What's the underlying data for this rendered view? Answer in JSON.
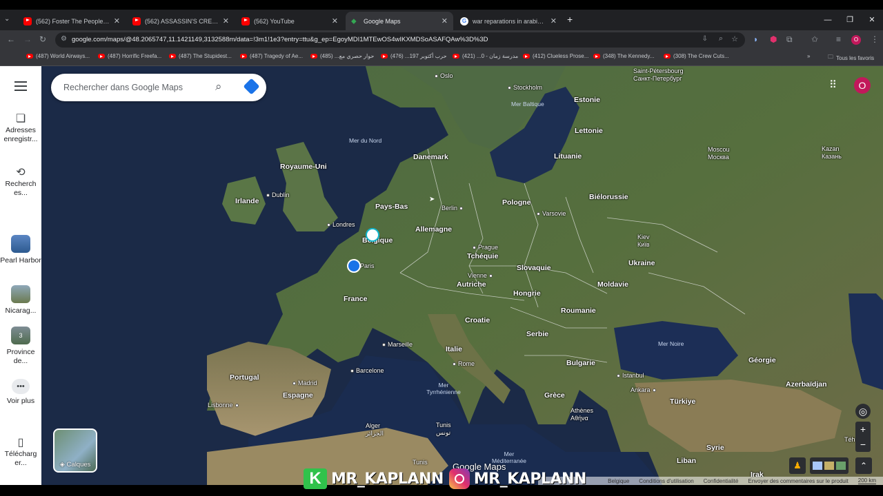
{
  "tabs": [
    {
      "title": "(562) Foster The People - Pump",
      "icon": "youtube-icon"
    },
    {
      "title": "(562) ASSASSIN'S CREED VALHA",
      "icon": "youtube-icon"
    },
    {
      "title": "(562) YouTube",
      "icon": "youtube-icon"
    },
    {
      "title": "Google Maps",
      "icon": "google-maps-icon",
      "active": true
    },
    {
      "title": "war reparations in arabic - Goo",
      "icon": "google-icon"
    }
  ],
  "address": {
    "url": "google.com/maps/@48.2065747,11.1421149,3132588m/data=!3m1!1e3?entry=ttu&g_ep=EgoyMDI1MTEwOS4wIKXMDSoASAFQAw%3D%3D"
  },
  "bookmarks": [
    "(487) World Airways...",
    "(487) Horrific Freefa...",
    "(487) The Stupidest...",
    "(487) Tragedy of Ae...",
    "حوار حصري مع... (485)",
    "حرب أكتوبر 197... (476)",
    "مدرسة زمان - 0... (421)",
    "(412) Clueless Prose...",
    "(348) The Kennedy...",
    "(308) The Crew Cuts..."
  ],
  "bookmarks_folder": "Tous les favoris",
  "profile_initial": "O",
  "sidebar": {
    "saved": "Adresses enregistr...",
    "recent": "Recherch es...",
    "places": [
      "Pearl Harbor",
      "Nicarag...",
      "Province de..."
    ],
    "places_badge": "3",
    "more": "Voir plus",
    "download": "Télécharg er..."
  },
  "search": {
    "placeholder": "Rechercher dans Google Maps"
  },
  "map": {
    "countries": [
      {
        "t": "Royaume-Uni"
      },
      {
        "t": "Irlande"
      },
      {
        "t": "Danemark"
      },
      {
        "t": "Pays-Bas"
      },
      {
        "t": "Belgique"
      },
      {
        "t": "Allemagne"
      },
      {
        "t": "Pologne"
      },
      {
        "t": "Tchéquie"
      },
      {
        "t": "Slovaquie"
      },
      {
        "t": "Autriche"
      },
      {
        "t": "Hongrie"
      },
      {
        "t": "France"
      },
      {
        "t": "Croatie"
      },
      {
        "t": "Serbie"
      },
      {
        "t": "Roumanie"
      },
      {
        "t": "Moldavie"
      },
      {
        "t": "Ukraine"
      },
      {
        "t": "Biélorussie"
      },
      {
        "t": "Lituanie"
      },
      {
        "t": "Lettonie"
      },
      {
        "t": "Estonie"
      },
      {
        "t": "Italie"
      },
      {
        "t": "Bulgarie"
      },
      {
        "t": "Grèce"
      },
      {
        "t": "Portugal"
      },
      {
        "t": "Espagne"
      },
      {
        "t": "Türkiye"
      },
      {
        "t": "Géorgie"
      },
      {
        "t": "Azerbaïdjan"
      },
      {
        "t": "Syrie"
      },
      {
        "t": "Liban"
      },
      {
        "t": "Irak"
      }
    ],
    "cities": [
      {
        "t": "Oslo"
      },
      {
        "t": "Stockholm"
      },
      {
        "t": "Dublin"
      },
      {
        "t": "Londres"
      },
      {
        "t": "Berlin"
      },
      {
        "t": "Varsovie"
      },
      {
        "t": "Paris"
      },
      {
        "t": "Prague"
      },
      {
        "t": "Vienne"
      },
      {
        "t": "Marseille"
      },
      {
        "t": "Barcelone"
      },
      {
        "t": "Madrid"
      },
      {
        "t": "Lisbonne"
      },
      {
        "t": "Rome"
      },
      {
        "t": "Istanbul"
      },
      {
        "t": "Ankara"
      }
    ],
    "cities_bilingual": [
      {
        "a": "Saint-Pétersbourg",
        "b": "Санкт-Петербург"
      },
      {
        "a": "Moscou",
        "b": "Москва"
      },
      {
        "a": "Kazan",
        "b": "Казань"
      },
      {
        "a": "Kiev",
        "b": "Київ"
      },
      {
        "a": "Athènes",
        "b": "Αθήνα"
      },
      {
        "a": "Alger",
        "b": "الجزائر"
      },
      {
        "a": "Tunis",
        "b": "تونس"
      }
    ],
    "seas": [
      {
        "t": "Mer Baltique"
      },
      {
        "t": "Mer du Nord"
      },
      {
        "t": "Mer Noire"
      },
      {
        "t": "Mer Tyrrhénienne"
      },
      {
        "t": "Mer Méditerranée"
      }
    ],
    "fragments": {
      "tunis_edge": "Tunis",
      "teh": "Téh"
    }
  },
  "layers_label": "Calques",
  "logo_text": "Google Maps",
  "footer": [
    "Belgique",
    "Conditions d'utilisation",
    "Confidentialité",
    "Envoyer des commentaires sur le produit",
    "200 km"
  ],
  "watermark": {
    "handle1": "MR_KAPLANN",
    "handle2": "MR_KAPLANN",
    "k": "K"
  }
}
